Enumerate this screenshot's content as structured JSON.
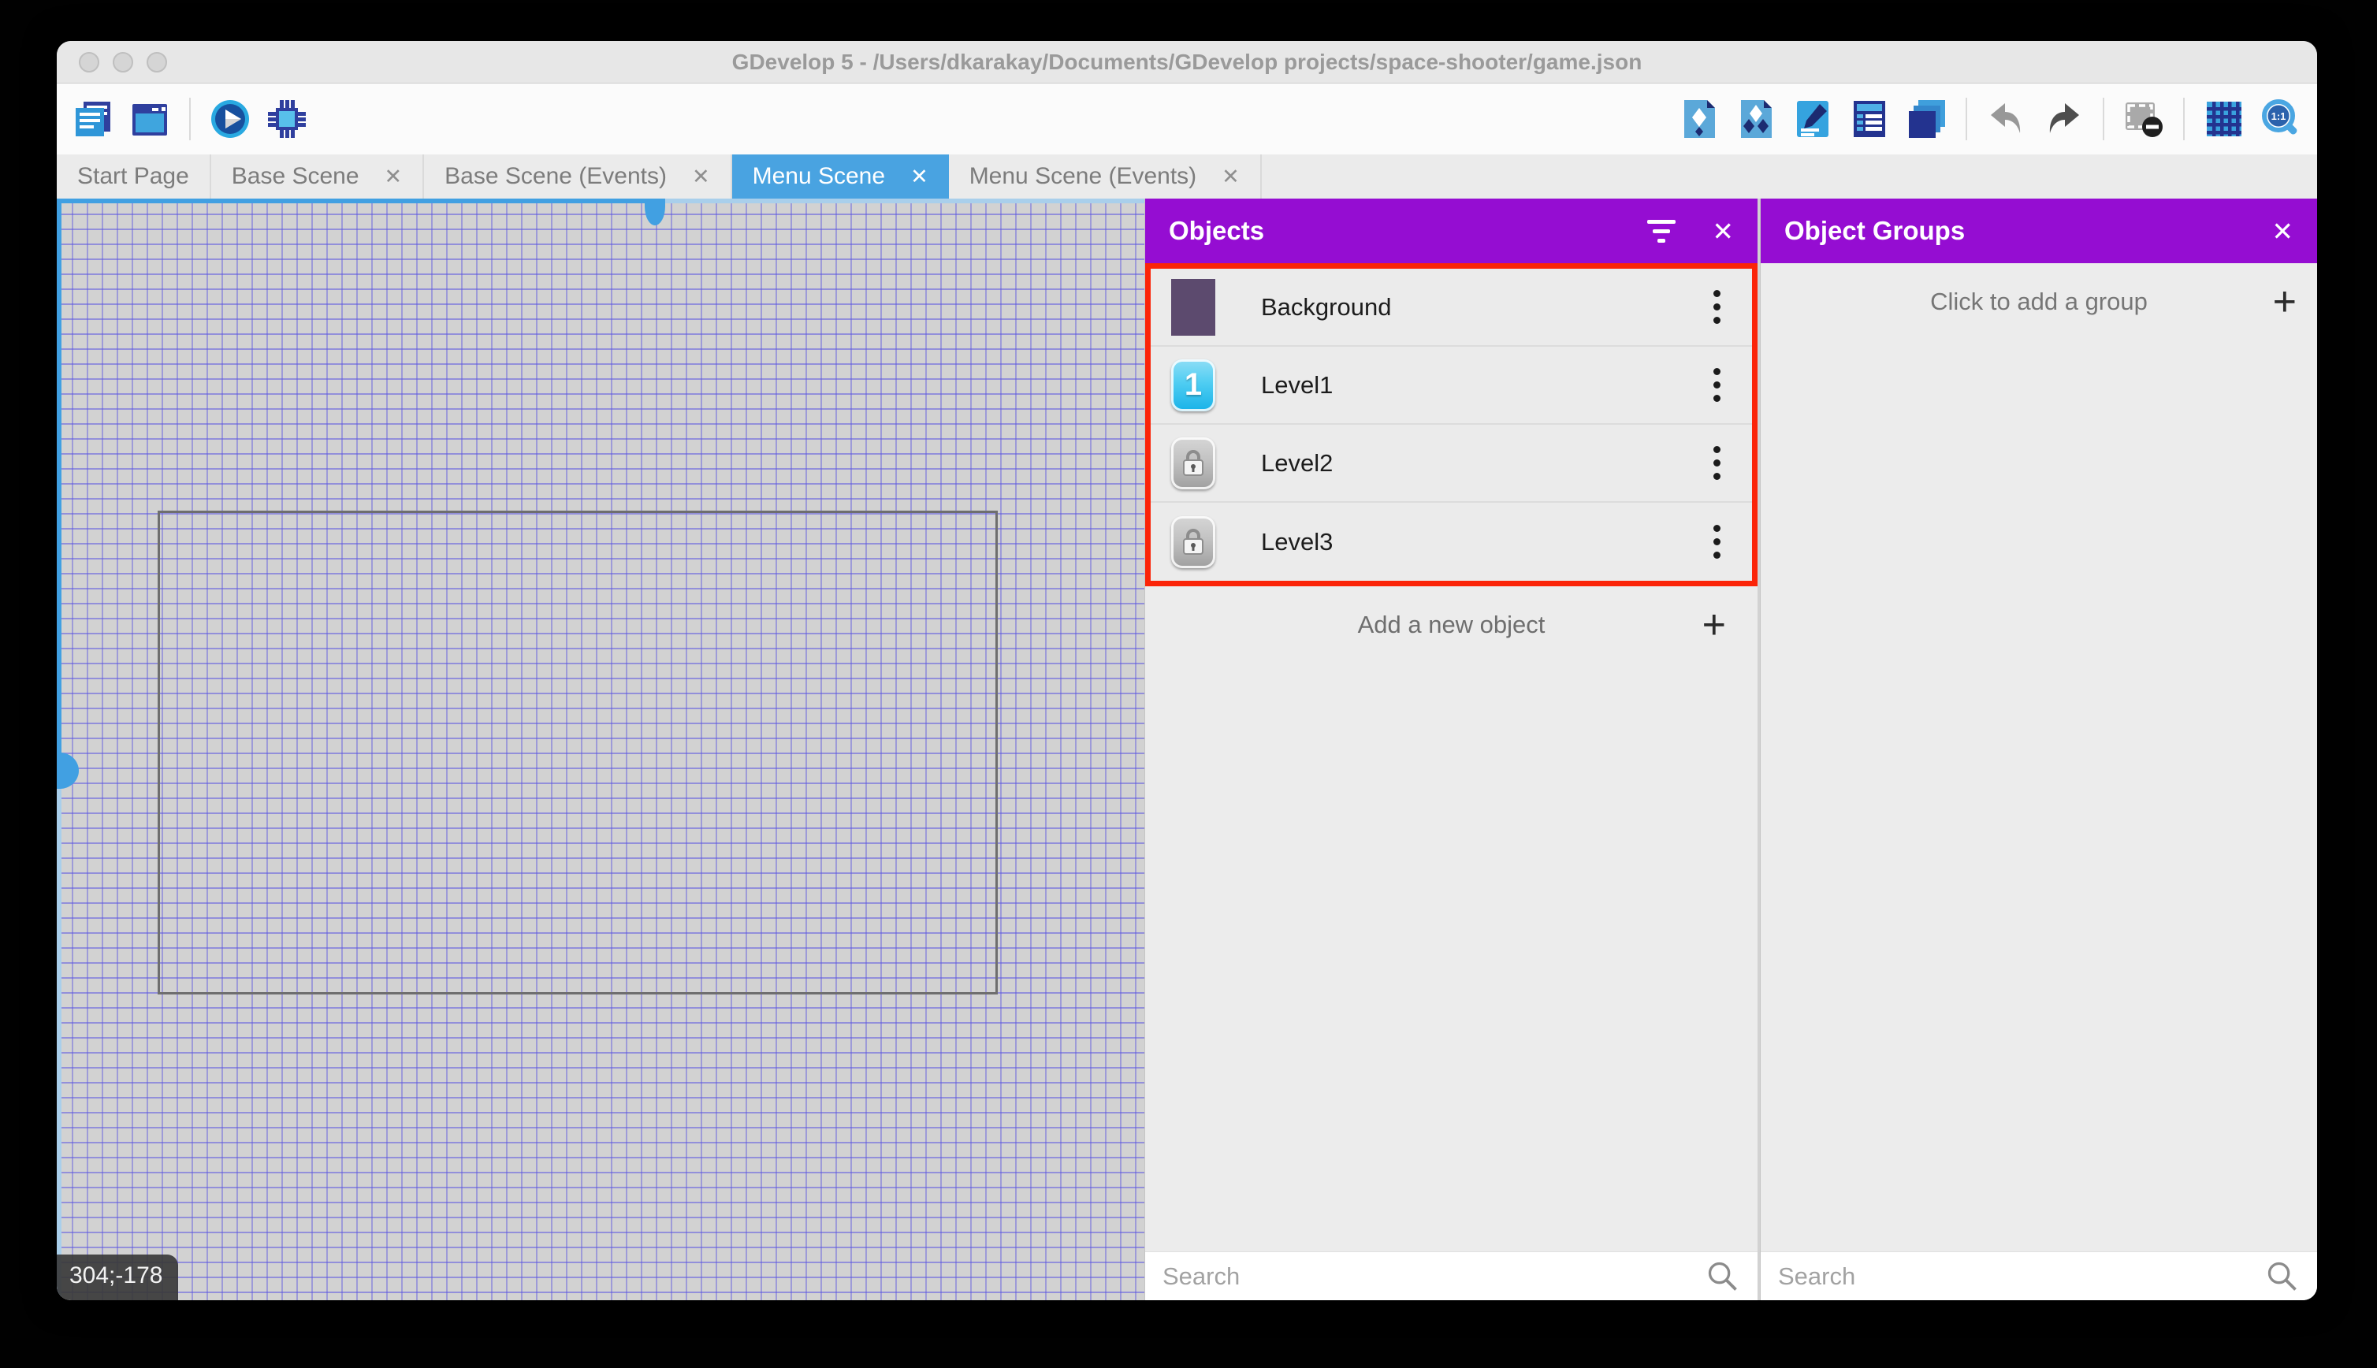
{
  "window": {
    "title": "GDevelop 5 - /Users/dkarakay/Documents/GDevelop projects/space-shooter/game.json"
  },
  "toolbar": {
    "left_icons": [
      "project-manager",
      "preview-window",
      "play-preview",
      "debug"
    ],
    "right_icons": [
      "objects-editor",
      "object-groups-editor",
      "properties",
      "instances-list",
      "layers",
      "undo",
      "redo",
      "toggle-window-mask",
      "toggle-grid",
      "zoom-1-1"
    ]
  },
  "tabs": [
    {
      "label": "Start Page",
      "closable": false,
      "active": false
    },
    {
      "label": "Base Scene",
      "closable": true,
      "active": false
    },
    {
      "label": "Base Scene (Events)",
      "closable": true,
      "active": false
    },
    {
      "label": "Menu Scene",
      "closable": true,
      "active": true
    },
    {
      "label": "Menu Scene (Events)",
      "closable": true,
      "active": false
    }
  ],
  "glyphs": {
    "close": "✕",
    "plus": "+",
    "level_one": "1",
    "zoom_ratio": "1:1"
  },
  "canvas": {
    "coordinates_badge": "304;-178"
  },
  "objects_panel": {
    "title": "Objects",
    "items": [
      {
        "name": "Background",
        "icon": "background-color-swatch"
      },
      {
        "name": "Level1",
        "icon": "level1-button"
      },
      {
        "name": "Level2",
        "icon": "locked-button"
      },
      {
        "name": "Level3",
        "icon": "locked-button"
      }
    ],
    "add_button_label": "Add a new object",
    "search_placeholder": "Search"
  },
  "object_groups_panel": {
    "title": "Object Groups",
    "empty_label": "Click to add a group",
    "search_placeholder": "Search"
  },
  "colors": {
    "accent_purple": "#950dd2",
    "highlight_red": "#fb2408",
    "active_tab_blue": "#49a3e1",
    "grid_line": "#5e58e0",
    "canvas_bg": "#d2d2d2"
  }
}
